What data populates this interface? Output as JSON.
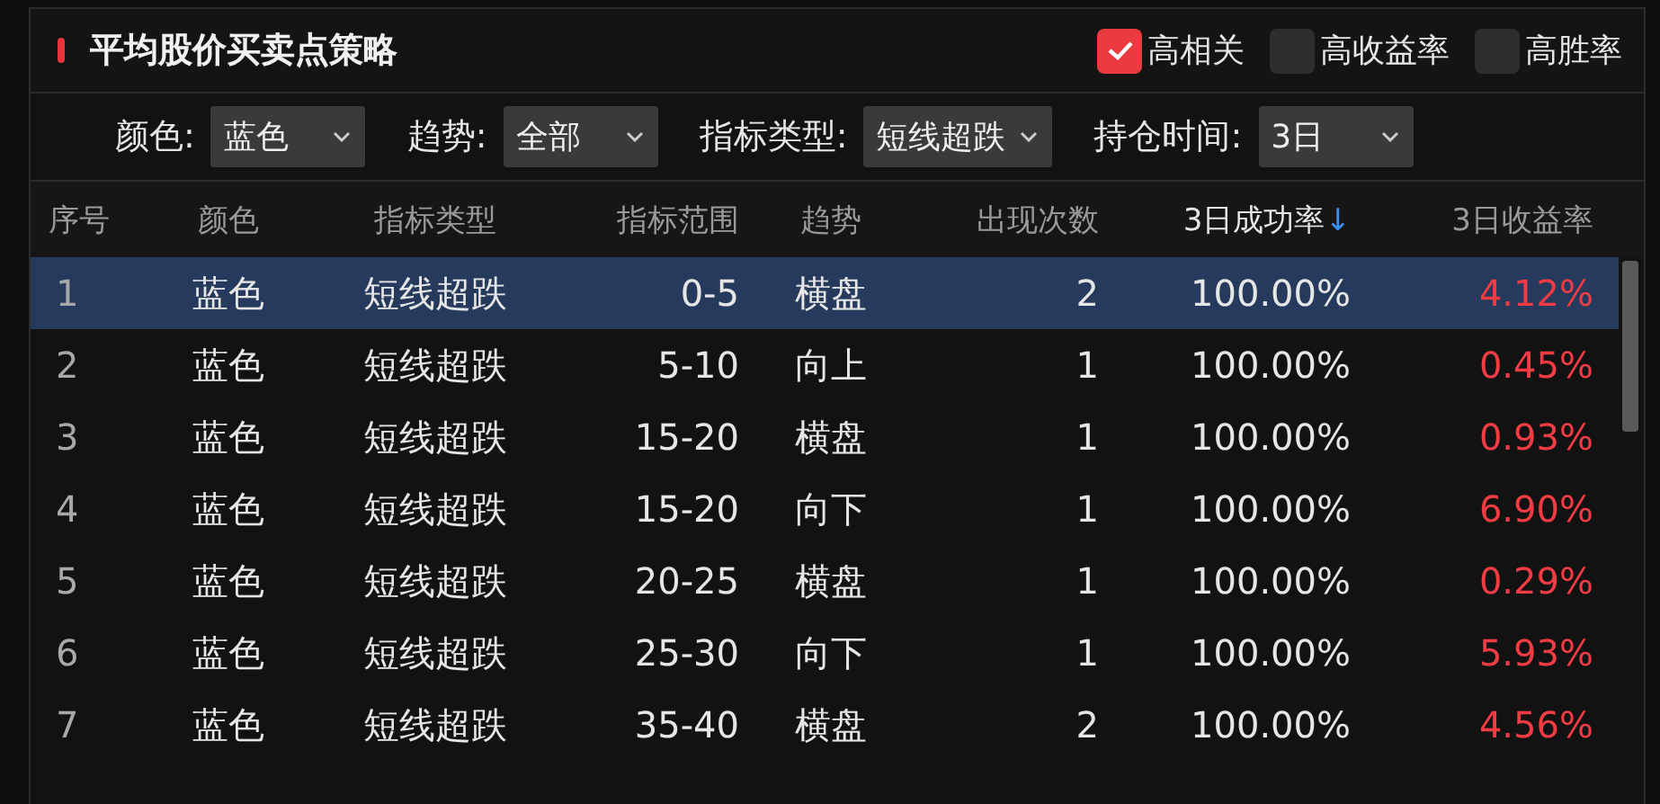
{
  "title": "平均股价买卖点策略",
  "toggles": [
    {
      "label": "高相关",
      "checked": true
    },
    {
      "label": "高收益率",
      "checked": false
    },
    {
      "label": "高胜率",
      "checked": false
    }
  ],
  "filters": [
    {
      "label": "颜色:",
      "value": "蓝色"
    },
    {
      "label": "趋势:",
      "value": "全部"
    },
    {
      "label": "指标类型:",
      "value": "短线超跌"
    },
    {
      "label": "持仓时间:",
      "value": "3日"
    }
  ],
  "table": {
    "columns": [
      {
        "label": "序号"
      },
      {
        "label": "颜色"
      },
      {
        "label": "指标类型"
      },
      {
        "label": "指标范围"
      },
      {
        "label": "趋势"
      },
      {
        "label": "出现次数"
      },
      {
        "label": "3日成功率",
        "sort_icon": "↓"
      },
      {
        "label": "3日收益率"
      }
    ],
    "rows": [
      {
        "selected": true,
        "cells": [
          "1",
          "蓝色",
          "短线超跌",
          "0-5",
          "横盘",
          "2",
          "100.00%",
          "4.12%"
        ]
      },
      {
        "selected": false,
        "cells": [
          "2",
          "蓝色",
          "短线超跌",
          "5-10",
          "向上",
          "1",
          "100.00%",
          "0.45%"
        ]
      },
      {
        "selected": false,
        "cells": [
          "3",
          "蓝色",
          "短线超跌",
          "15-20",
          "横盘",
          "1",
          "100.00%",
          "0.93%"
        ]
      },
      {
        "selected": false,
        "cells": [
          "4",
          "蓝色",
          "短线超跌",
          "15-20",
          "向下",
          "1",
          "100.00%",
          "6.90%"
        ]
      },
      {
        "selected": false,
        "cells": [
          "5",
          "蓝色",
          "短线超跌",
          "20-25",
          "横盘",
          "1",
          "100.00%",
          "0.29%"
        ]
      },
      {
        "selected": false,
        "cells": [
          "6",
          "蓝色",
          "短线超跌",
          "25-30",
          "向下",
          "1",
          "100.00%",
          "5.93%"
        ]
      },
      {
        "selected": false,
        "cells": [
          "7",
          "蓝色",
          "短线超跌",
          "35-40",
          "横盘",
          "2",
          "100.00%",
          "4.56%"
        ]
      }
    ]
  }
}
